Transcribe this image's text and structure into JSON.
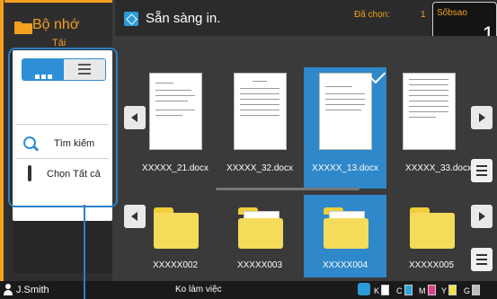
{
  "storage": {
    "line1": "Bộ nhớ",
    "line2": "Tải"
  },
  "view_toggle": {
    "tile_icon": "tile-view-icon",
    "list_icon": "list-view-icon"
  },
  "tools": {
    "search_label": "Tìm kiếm",
    "select_all_label": "Chọn Tất cả"
  },
  "header": {
    "status": "Sẵn sàng in.",
    "selected_label": "Đã chọn:",
    "selected_value": "1"
  },
  "copies": {
    "label": "Sốbsao",
    "value": "1"
  },
  "documents": [
    {
      "name": "XXXXX_21.docx",
      "selected": false
    },
    {
      "name": "XXXXX_32.docx",
      "selected": false
    },
    {
      "name": "XXXXX_13.docx",
      "selected": true
    },
    {
      "name": "XXXXX_33.docx",
      "selected": false
    }
  ],
  "folders": [
    {
      "name": "XXXXX002",
      "selected": false
    },
    {
      "name": "XXXXX003",
      "selected": false
    },
    {
      "name": "XXXXX004",
      "selected": true
    },
    {
      "name": "XXXXX005",
      "selected": false
    }
  ],
  "status_bar": {
    "user": "J.Smith",
    "state": "Ko làm việc",
    "inks": [
      {
        "label": "K",
        "color": "#ffffff"
      },
      {
        "label": "C",
        "color": "#2ba6d9"
      },
      {
        "label": "M",
        "color": "#e0408a"
      },
      {
        "label": "Y",
        "color": "#f2e14a"
      },
      {
        "label": "G",
        "color": "#bdbdbd"
      }
    ]
  },
  "colors": {
    "accent": "#f3a021",
    "selection": "#2f88c9",
    "callout": "#2b7fc5"
  }
}
